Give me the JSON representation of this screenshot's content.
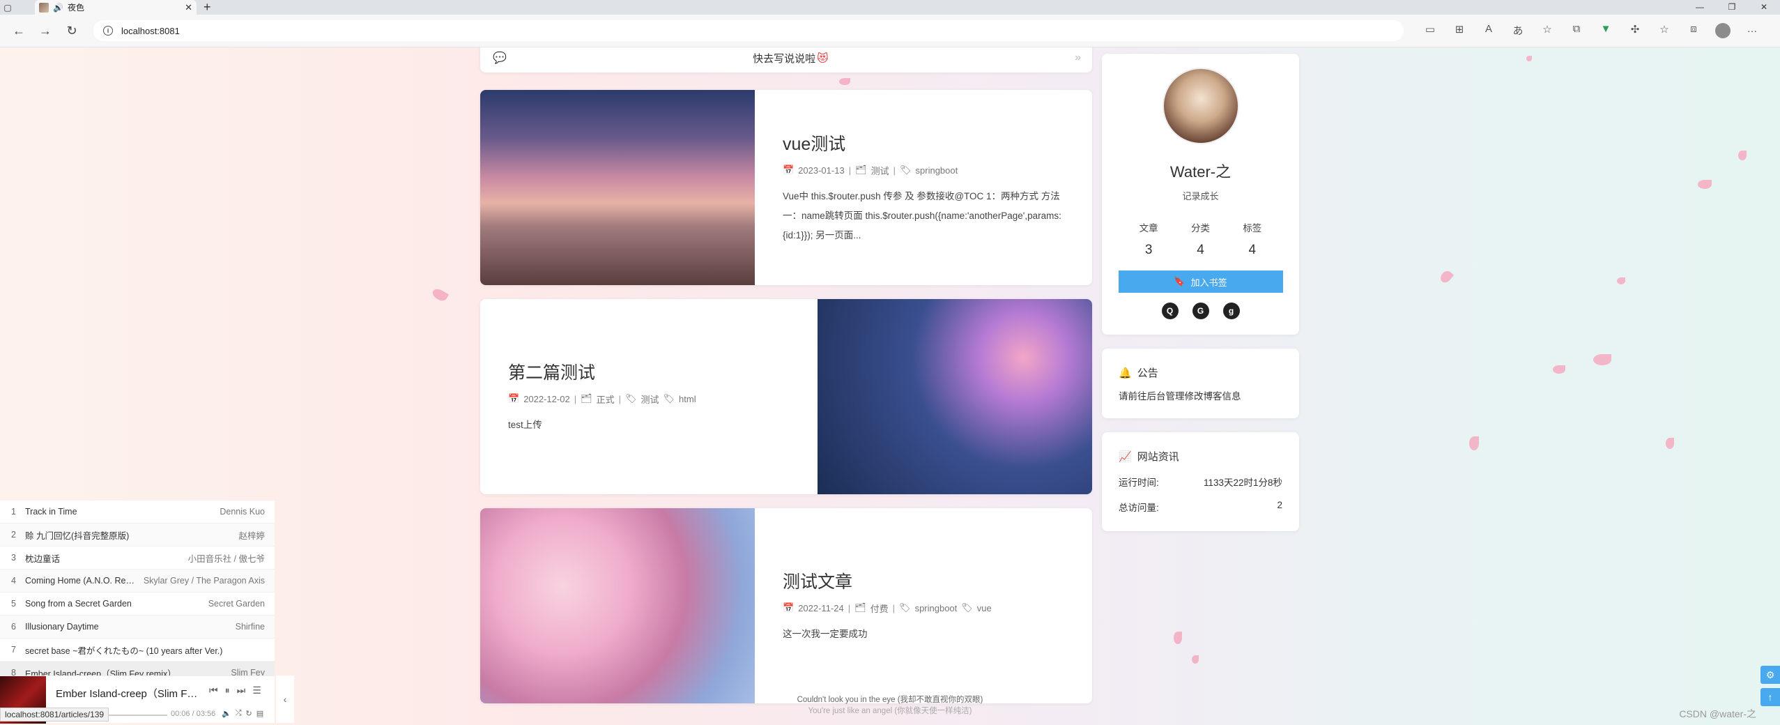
{
  "browser": {
    "tab_title": "夜色",
    "url": "localhost:8081",
    "status_url": "localhost:8081/articles/139"
  },
  "talk": {
    "text": "快去写说说啦",
    "emoji": "😻"
  },
  "posts": [
    {
      "title": "vue测试",
      "date": "2023-01-13",
      "category": "测试",
      "tags": [
        "springboot"
      ],
      "excerpt": "Vue中 this.$router.push 传参 及 参数接收@TOC 1：两种方式 方法一：name跳转页面 this.$router.push({name:'anotherPage',params:{id:1}}); 另一页面..."
    },
    {
      "title": "第二篇测试",
      "date": "2022-12-02",
      "category": "正式",
      "tags": [
        "测试",
        "html"
      ],
      "excerpt": "test上传"
    },
    {
      "title": "测试文章",
      "date": "2022-11-24",
      "category": "付费",
      "tags": [
        "springboot",
        "vue"
      ],
      "excerpt": "这一次我一定要成功"
    }
  ],
  "profile": {
    "name": "Water-之",
    "motto": "记录成长",
    "stats": [
      {
        "label": "文章",
        "value": "3"
      },
      {
        "label": "分类",
        "value": "4"
      },
      {
        "label": "标签",
        "value": "4"
      }
    ],
    "bookmark_label": "加入书签",
    "socials": [
      "qq-icon",
      "github-icon",
      "gitee-icon"
    ]
  },
  "notice": {
    "title": "公告",
    "text": "请前往后台管理修改博客信息"
  },
  "site_info": {
    "title": "网站资讯",
    "run_label": "运行时间:",
    "run_value": "1133天22时1分8秒",
    "visit_label": "总访问量:",
    "visit_value": "2"
  },
  "playlist": [
    {
      "idx": "1",
      "song": "Track in Time",
      "artist": "Dennis Kuo"
    },
    {
      "idx": "2",
      "song": "赊 九门回忆(抖音完整原版)",
      "artist": "赵梓婷"
    },
    {
      "idx": "3",
      "song": "枕边童话",
      "artist": "小田音乐社 / 傲七爷"
    },
    {
      "idx": "4",
      "song": "Coming Home (A.N.O. Remix)",
      "artist": "Skylar Grey / The Paragon Axis"
    },
    {
      "idx": "5",
      "song": "Song from a Secret Garden",
      "artist": "Secret Garden"
    },
    {
      "idx": "6",
      "song": "Illusionary Daytime",
      "artist": "Shirfine"
    },
    {
      "idx": "7",
      "song": "secret base ~君がくれたもの~ (10 years after Ver.)",
      "artist": ""
    },
    {
      "idx": "8",
      "song": "Ember Island-creep（Slim Fey remix）",
      "artist": "Slim Fey"
    }
  ],
  "player": {
    "track": "Ember Island-creep（Slim Fey r...",
    "time": "00:06 / 03:56",
    "progress": 0.025
  },
  "lyrics": {
    "line1": "Couldn't look you in the eye (我却不敢直视你的双眼)",
    "line2": "You're just like an angel (你就像天使一样纯洁)"
  },
  "watermark": "CSDN @water-之",
  "colors": {
    "accent": "#49a9ee",
    "petal": "#f5a9bf"
  }
}
